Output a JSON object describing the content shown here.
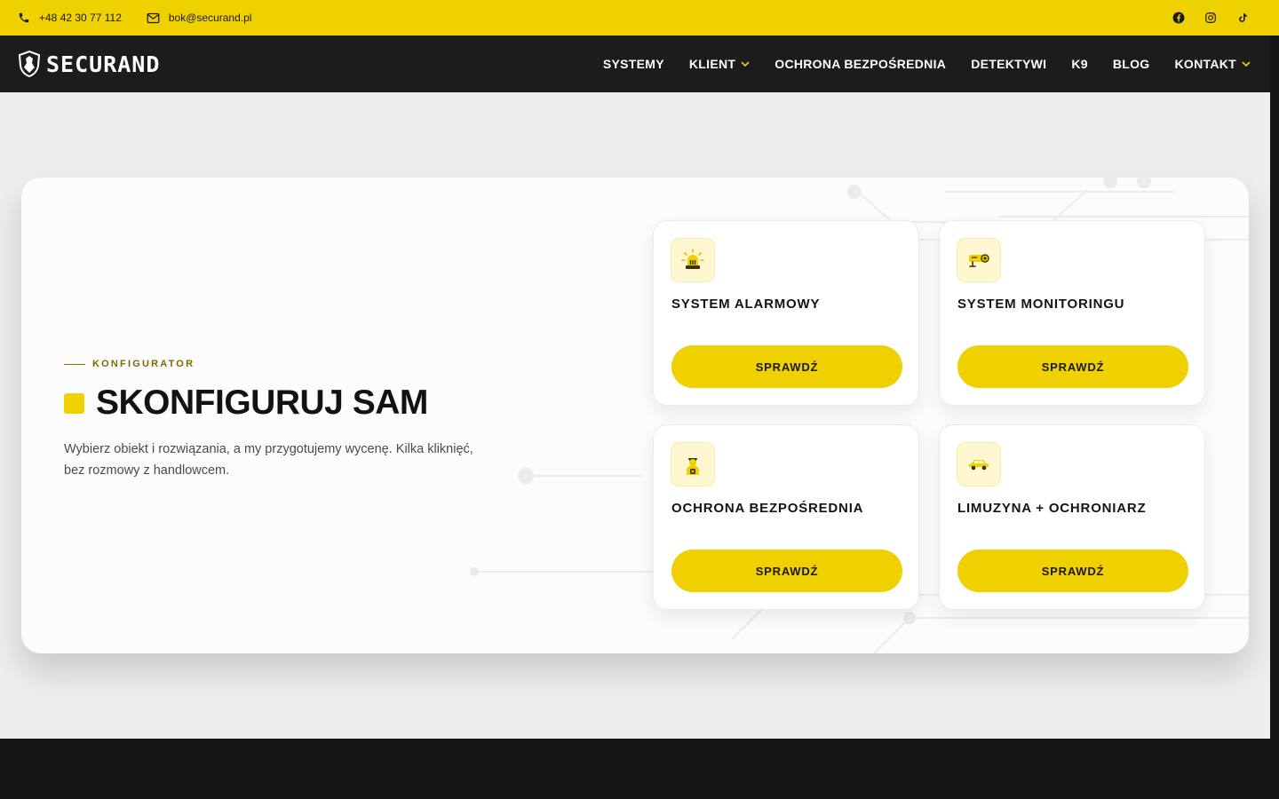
{
  "topbar": {
    "phone": "+48 42 30 77 112",
    "email": "bok@securand.pl",
    "socials": [
      "facebook-icon",
      "instagram-icon",
      "tiktok-icon"
    ]
  },
  "navbar": {
    "logo_text": "SECURAND",
    "items": [
      {
        "label": "SYSTEMY",
        "dropdown": false
      },
      {
        "label": "KLIENT",
        "dropdown": true
      },
      {
        "label": "OCHRONA BEZPOŚREDNIA",
        "dropdown": false
      },
      {
        "label": "DETEKTYWI",
        "dropdown": false
      },
      {
        "label": "K9",
        "dropdown": false
      },
      {
        "label": "BLOG",
        "dropdown": false
      },
      {
        "label": "KONTAKT",
        "dropdown": true
      }
    ]
  },
  "hero": {
    "eyebrow": "KONFIGURATOR",
    "title": "SKONFIGURUJ SAM",
    "lead": "Wybierz obiekt i rozwiązania, a my przygotujemy wycenę. Kilka kliknięć, bez rozmowy z handlowcem."
  },
  "options": [
    {
      "title": "SYSTEM ALARMOWY",
      "button": "SPRAWDŹ",
      "icon": "alarm-siren-icon"
    },
    {
      "title": "SYSTEM MONITORINGU",
      "button": "SPRAWDŹ",
      "icon": "cctv-camera-icon"
    },
    {
      "title": "OCHRONA BEZPOŚREDNIA",
      "button": "SPRAWDŹ",
      "icon": "security-guard-icon"
    },
    {
      "title": "LIMUZYNA + OCHRONIARZ",
      "button": "SPRAWDŹ",
      "icon": "limousine-icon"
    }
  ],
  "colors": {
    "accent": "#efd000",
    "dark": "#1c1c1c",
    "background": "#eeeeef"
  }
}
